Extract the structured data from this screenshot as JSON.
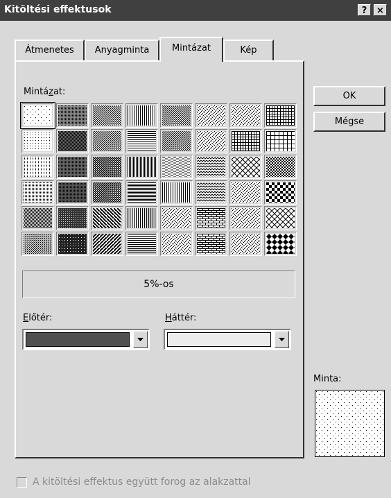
{
  "window": {
    "title": "Kitöltési effektusok",
    "help_label": "?",
    "close_label": "×"
  },
  "tabs": [
    {
      "label": "Átmenetes",
      "active": false
    },
    {
      "label": "Anyagminta",
      "active": false
    },
    {
      "label": "Mintázat",
      "active": true
    },
    {
      "label": "Kép",
      "active": false
    }
  ],
  "pattern_section": {
    "label_pre": "Mintá",
    "label_u": "z",
    "label_post": "at:"
  },
  "patterns": [
    "5%",
    "50%",
    "light downward diagonal",
    "light vertical",
    "dashed downward diagonal",
    "small confetti",
    "divot",
    "small grid",
    "10%",
    "60%",
    "light upward diagonal",
    "light horizontal",
    "dashed upward diagonal",
    "large confetti",
    "dotted grid",
    "large grid",
    "20%",
    "70%",
    "dark downward diagonal",
    "narrow vertical",
    "dashed horizontal",
    "zig zag",
    "dotted diamond",
    "small checker board",
    "25%",
    "75%",
    "dark upward diagonal",
    "narrow horizontal",
    "dashed vertical",
    "wave",
    "shingle",
    "large checker board",
    "30%",
    "80%",
    "wide downward diagonal",
    "dark vertical",
    "small confetti",
    "diagonal brick",
    "trellis",
    "outlined diamond",
    "40%",
    "90%",
    "wide upward diagonal",
    "dark horizontal",
    "large confetti",
    "horizontal brick",
    "sphere",
    "solid diamond"
  ],
  "selected_pattern": {
    "index": 0,
    "name": "5%-os"
  },
  "foreground": {
    "label_u": "E",
    "label_post": "lőtér:",
    "color": "#505050"
  },
  "background": {
    "label_u": "H",
    "label_post": "áttér:",
    "color": "#ececec"
  },
  "buttons": {
    "ok": "OK",
    "cancel": "Mégse"
  },
  "preview": {
    "label": "Minta:"
  },
  "rotate_with_shape": {
    "label": "A kitöltési effektus együtt forog az alakzattal",
    "checked": false,
    "enabled": false
  }
}
